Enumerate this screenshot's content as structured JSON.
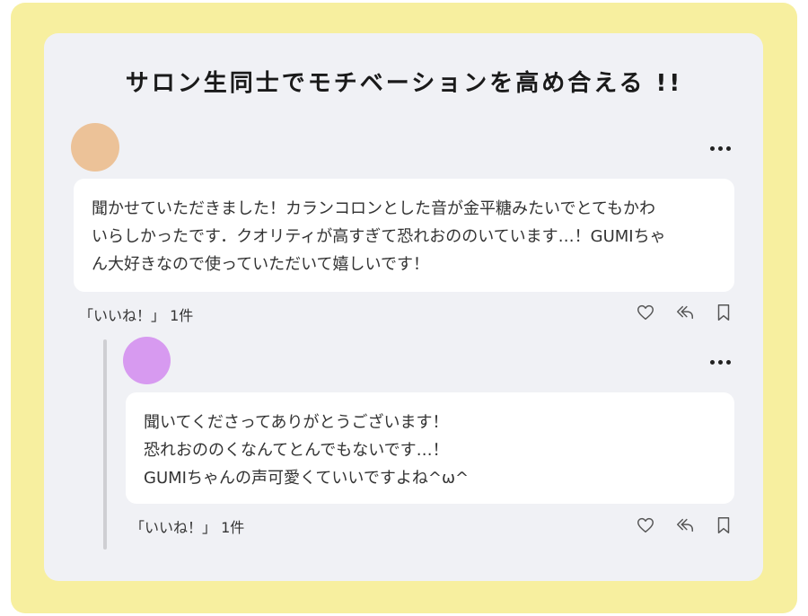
{
  "title": "サロン生同士でモチベーションを高め合える !!",
  "colors": {
    "frame": "#f7ef9f",
    "card": "#f0f1f5",
    "avatar_comment": "#ecc298",
    "avatar_reply": "#d79af0"
  },
  "comment": {
    "lines": [
      "聞かせていただきました！カランコロンとした音が金平糖みたいでとてもかわ",
      "いらしかったです．クオリティが高すぎて恐れおののいています…！GUMIちゃ",
      "ん大好きなので使っていただいて嬉しいです！"
    ],
    "likes": "「いいね！」 1件"
  },
  "reply": {
    "lines": [
      "聞いてくださってありがとうございます！",
      "恐れおののくなんてとんでもないです…！",
      "GUMIちゃんの声可愛くていいですよね^ω^"
    ],
    "likes": "「いいね！」 1件"
  },
  "icons": {
    "more": "more-dots-icon",
    "like": "heart-icon",
    "reply": "reply-arrow-icon",
    "save": "bookmark-icon"
  }
}
